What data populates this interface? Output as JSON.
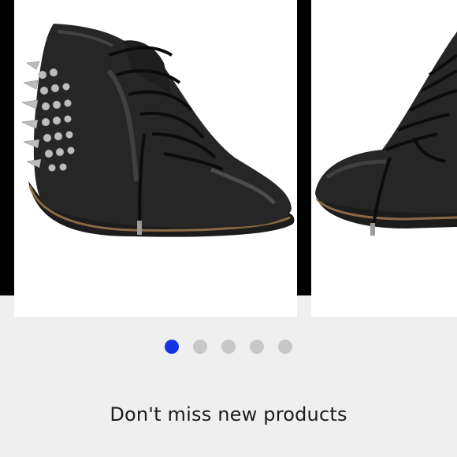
{
  "carousel": {
    "slide_1": {
      "image_label": "black leather lace-up sneaker with silver spikes on heel"
    },
    "slide_2": {
      "image_label": "black leather lace-up sneaker close-up"
    },
    "pagination": {
      "count": 5,
      "active_index": 0,
      "active_color": "#1432e6",
      "inactive_color": "#c8c8c8"
    }
  },
  "banner": {
    "text": "Don't miss new products"
  }
}
